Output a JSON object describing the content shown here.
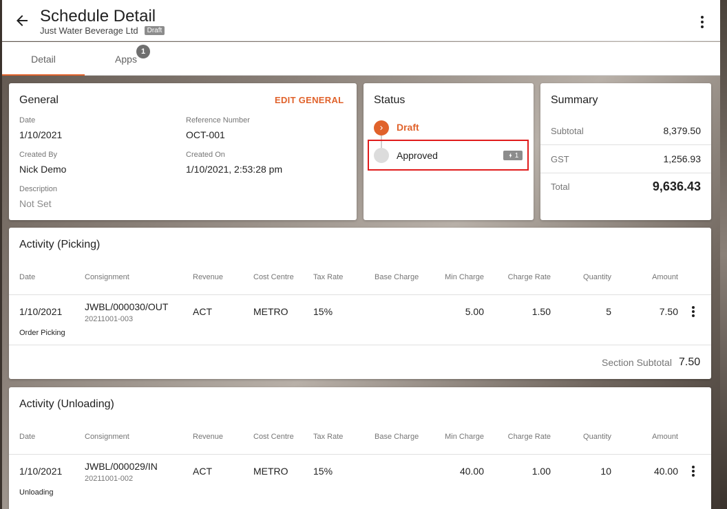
{
  "header": {
    "title": "Schedule Detail",
    "company": "Just Water Beverage Ltd",
    "status_badge": "Draft"
  },
  "tabs": [
    {
      "label": "Detail",
      "active": true
    },
    {
      "label": "Apps",
      "badge": "1"
    }
  ],
  "general": {
    "title": "General",
    "edit_label": "EDIT GENERAL",
    "date_label": "Date",
    "date_value": "1/10/2021",
    "reference_label": "Reference Number",
    "reference_value": "OCT-001",
    "created_by_label": "Created By",
    "created_by_value": "Nick Demo",
    "created_on_label": "Created On",
    "created_on_value": "1/10/2021, 2:53:28 pm",
    "description_label": "Description",
    "description_value": "Not Set"
  },
  "status": {
    "title": "Status",
    "steps": [
      {
        "label": "Draft",
        "state": "active"
      },
      {
        "label": "Approved",
        "state": "pending",
        "chip": "1"
      }
    ]
  },
  "summary": {
    "title": "Summary",
    "subtotal_label": "Subtotal",
    "subtotal_value": "8,379.50",
    "gst_label": "GST",
    "gst_value": "1,256.93",
    "total_label": "Total",
    "total_value": "9,636.43"
  },
  "columns": [
    "Date",
    "Consignment",
    "Revenue",
    "Cost Centre",
    "Tax Rate",
    "Base Charge",
    "Min Charge",
    "Charge Rate",
    "Quantity",
    "Amount"
  ],
  "picking": {
    "title": "Activity (Picking)",
    "row": {
      "date": "1/10/2021",
      "consignment": "JWBL/000030/OUT",
      "consignment_sub": "20211001-003",
      "revenue": "ACT",
      "cost_centre": "METRO",
      "tax_rate": "15%",
      "base_charge": "",
      "min_charge": "5.00",
      "charge_rate": "1.50",
      "quantity": "5",
      "amount": "7.50",
      "note": "Order Picking"
    },
    "subtotal_label": "Section Subtotal",
    "subtotal_value": "7.50"
  },
  "unloading": {
    "title": "Activity (Unloading)",
    "row": {
      "date": "1/10/2021",
      "consignment": "JWBL/000029/IN",
      "consignment_sub": "20211001-002",
      "revenue": "ACT",
      "cost_centre": "METRO",
      "tax_rate": "15%",
      "base_charge": "",
      "min_charge": "40.00",
      "charge_rate": "1.00",
      "quantity": "10",
      "amount": "40.00",
      "note": "Unloading"
    }
  },
  "colors": {
    "accent": "#e0622b",
    "highlight_border": "#e01b1b",
    "badge_gray": "#8c8c8c"
  },
  "icons": [
    "back-arrow-icon",
    "more-vertical-icon",
    "chevron-right-icon",
    "lightning-icon"
  ]
}
